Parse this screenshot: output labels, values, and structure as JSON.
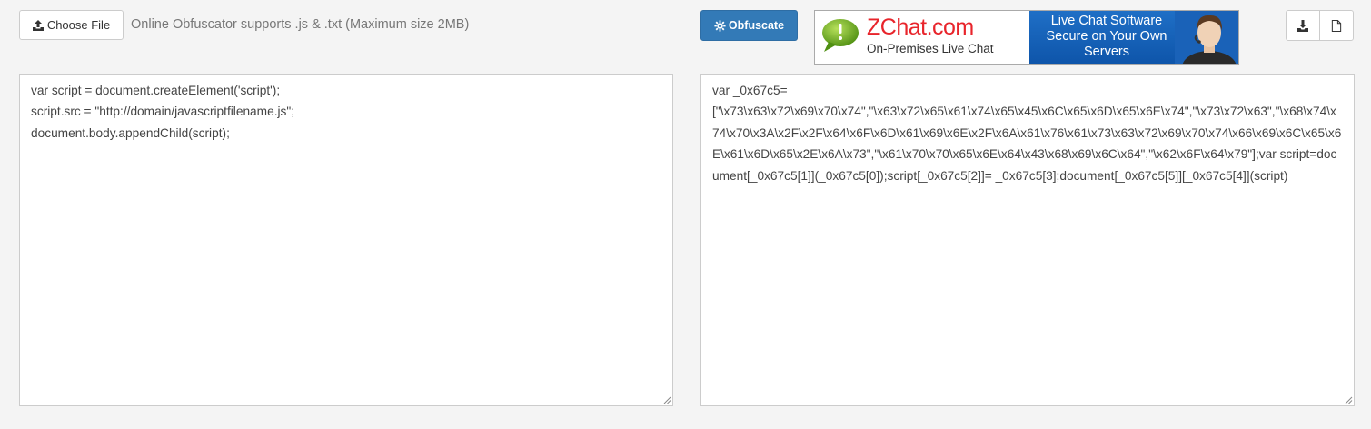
{
  "toolbar": {
    "choose_file_label": "Choose File",
    "hint": "Online Obfuscator supports .js & .txt (Maximum size 2MB)",
    "obfuscate_label": "Obfuscate",
    "accent_color": "#337ab7"
  },
  "banner": {
    "brand": "ZChat.com",
    "tagline": "On-Premises Live Chat",
    "right_line1": "Live Chat Software",
    "right_line2": "Secure on Your Own",
    "right_line3": "Servers",
    "brand_color": "#e8242b"
  },
  "icons": {
    "download": "download-icon",
    "new_file": "file-icon",
    "upload": "upload-icon",
    "gear": "gear-icon"
  },
  "input": {
    "code": "var script = document.createElement('script');\nscript.src = \"http://domain/javascriptfilename.js\";\ndocument.body.appendChild(script);"
  },
  "output": {
    "code": "var _0x67c5=\n[\"\\x73\\x63\\x72\\x69\\x70\\x74\",\"\\x63\\x72\\x65\\x61\\x74\\x65\\x45\\x6C\\x65\\x6D\\x65\\x6E\\x74\",\"\\x73\\x72\\x63\",\"\\x68\\x74\\x74\\x70\\x3A\\x2F\\x2F\\x64\\x6F\\x6D\\x61\\x69\\x6E\\x2F\\x6A\\x61\\x76\\x61\\x73\\x63\\x72\\x69\\x70\\x74\\x66\\x69\\x6C\\x65\\x6E\\x61\\x6D\\x65\\x2E\\x6A\\x73\",\"\\x61\\x70\\x70\\x65\\x6E\\x64\\x43\\x68\\x69\\x6C\\x64\",\"\\x62\\x6F\\x64\\x79\"];var script=document[_0x67c5[1]](_0x67c5[0]);script[_0x67c5[2]]= _0x67c5[3];document[_0x67c5[5]][_0x67c5[4]](script)"
  }
}
